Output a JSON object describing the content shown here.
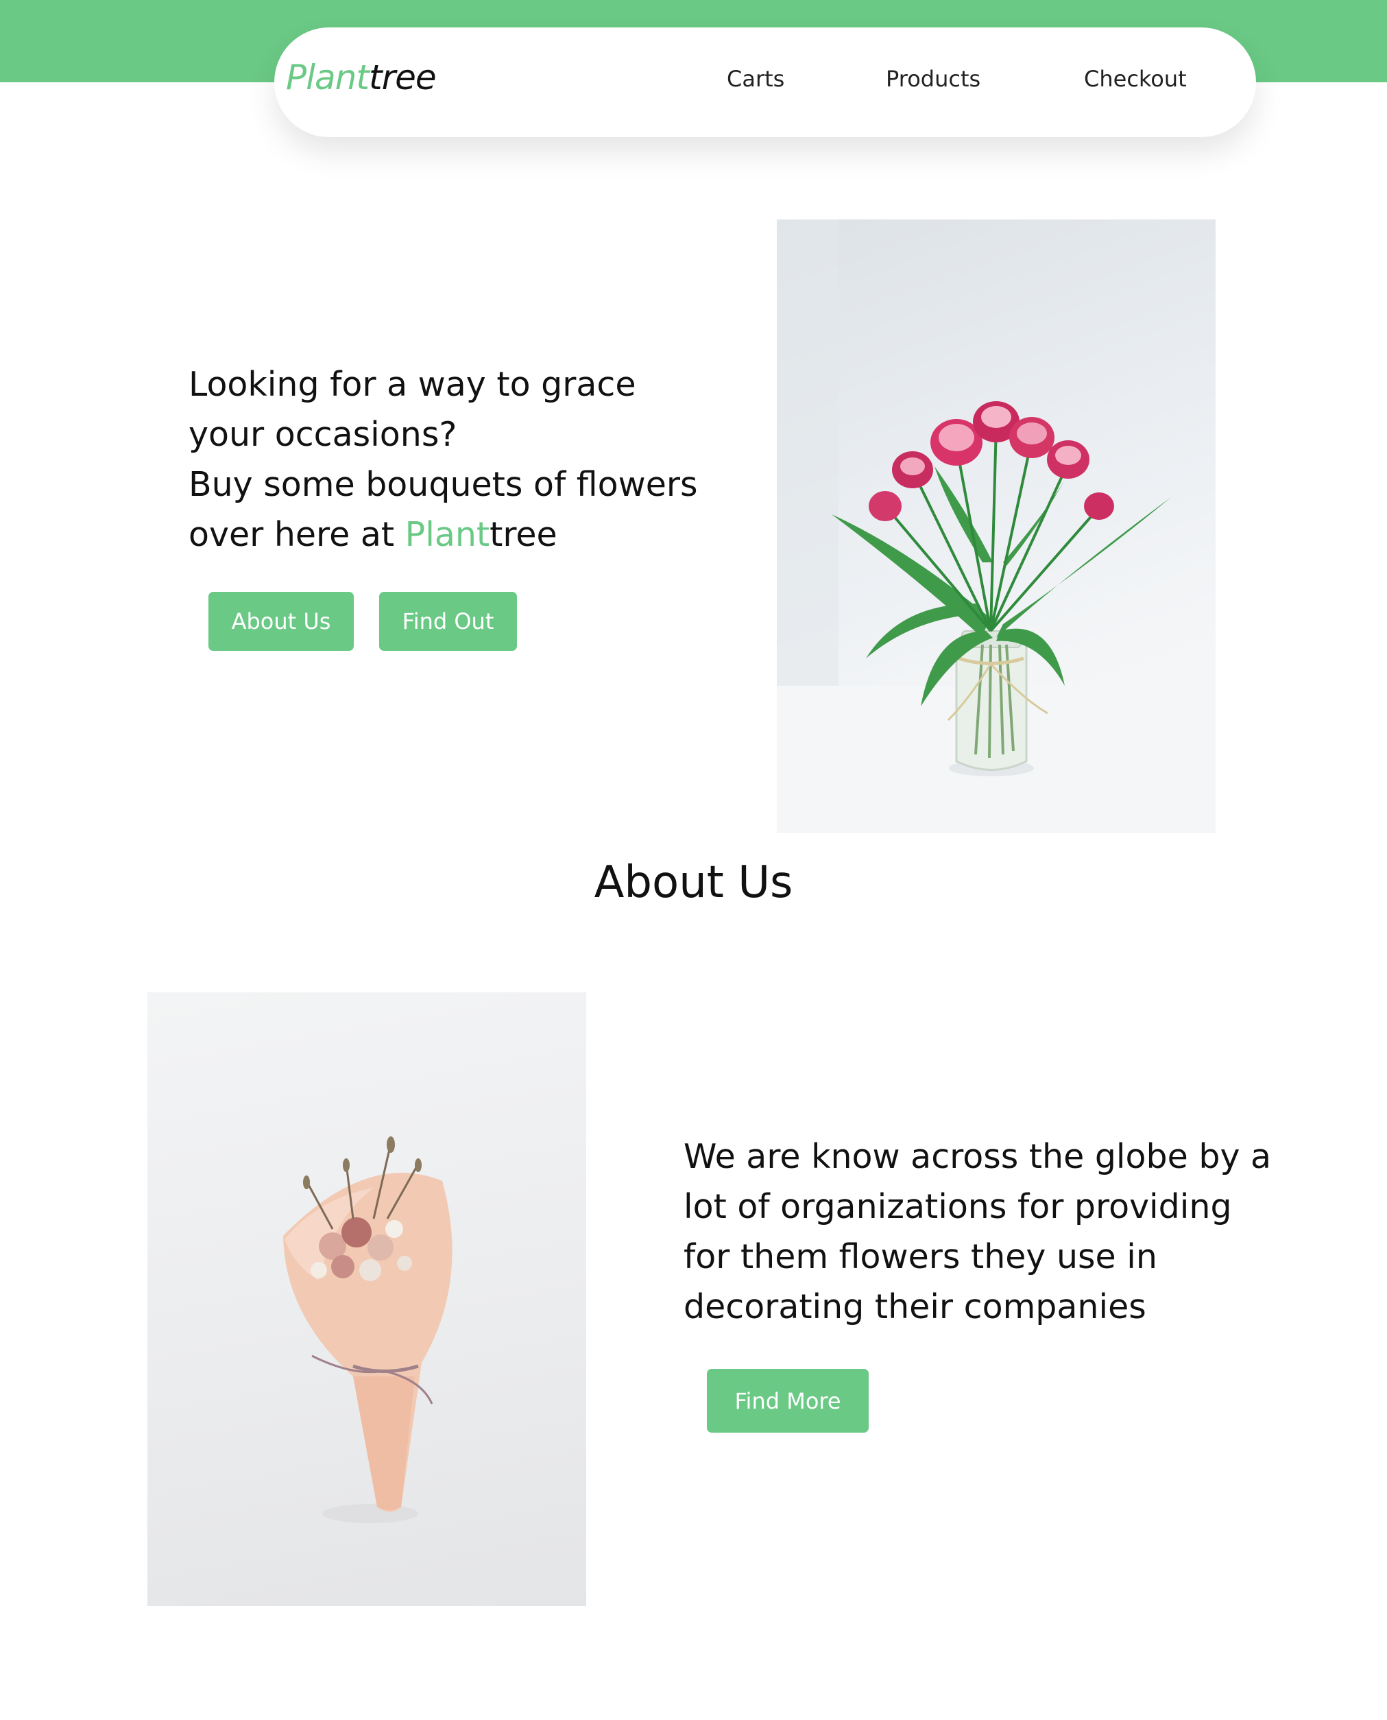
{
  "brand": {
    "logo_accent": "Plant",
    "logo_rest": "tree",
    "accent_color": "#6ac985"
  },
  "nav": {
    "items": [
      {
        "label": "Carts"
      },
      {
        "label": "Products"
      },
      {
        "label": "Checkout"
      }
    ]
  },
  "hero": {
    "line1": "Looking for a way to grace",
    "line2": "your occasions?",
    "line3": "Buy some bouquets of flowers",
    "line4_prefix": "over here at ",
    "line4_accent": "Plant",
    "line4_rest": "tree",
    "buttons": [
      {
        "label": "About Us"
      },
      {
        "label": "Find Out"
      }
    ],
    "image_icon": "tulips-vase-photo"
  },
  "about": {
    "title": "About Us",
    "text": "We are know across the globe by a lot of organizations for providing for them flowers they use in decorating their companies",
    "button_label": "Find More",
    "image_icon": "wrapped-bouquet-photo"
  }
}
